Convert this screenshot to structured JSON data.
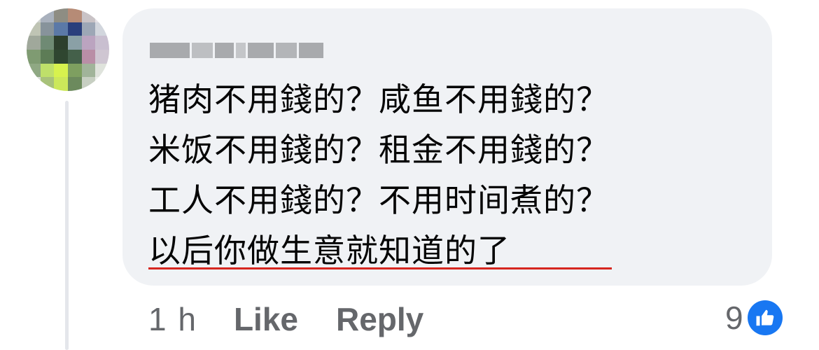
{
  "colors": {
    "bubble": "#f0f2f5",
    "text": "#050505",
    "secondary": "#65676b",
    "underline": "#d6261f",
    "like_blue": "#1877f2"
  },
  "avatar": {
    "mosaic": [
      "#cfd3cf",
      "#a9b1bd",
      "#8e8d83",
      "#b68b76",
      "#c9c3c6",
      "#e4e1e6",
      "#bfc4b4",
      "#87939b",
      "#5b79a7",
      "#2a3f7c",
      "#9da7b6",
      "#d2d6dd",
      "#a0a89b",
      "#6f8a74",
      "#2d3f2d",
      "#8aa0a6",
      "#bba4c0",
      "#c9bfd0",
      "#7f9b72",
      "#5d7c56",
      "#2f4630",
      "#44604a",
      "#b98ea6",
      "#cfc6d2",
      "#8fa883",
      "#bfe06a",
      "#d7f24e",
      "#7e9f60",
      "#a1b49a",
      "#dfe3dc",
      "#d8ddd6",
      "#a8c27a",
      "#cce85a",
      "#6c8a5d",
      "#c7cfc2",
      "#eef0ec"
    ]
  },
  "comment": {
    "lines": [
      "猪肉不用錢的？咸鱼不用錢的？",
      "米饭不用錢的？租金不用錢的？",
      "工人不用錢的？不用时间煮的？",
      "以后你做生意就知道的了"
    ]
  },
  "actions": {
    "time": "1 h",
    "like": "Like",
    "reply": "Reply"
  },
  "reactions": {
    "count": "9",
    "icon": "thumbs-up-icon"
  }
}
